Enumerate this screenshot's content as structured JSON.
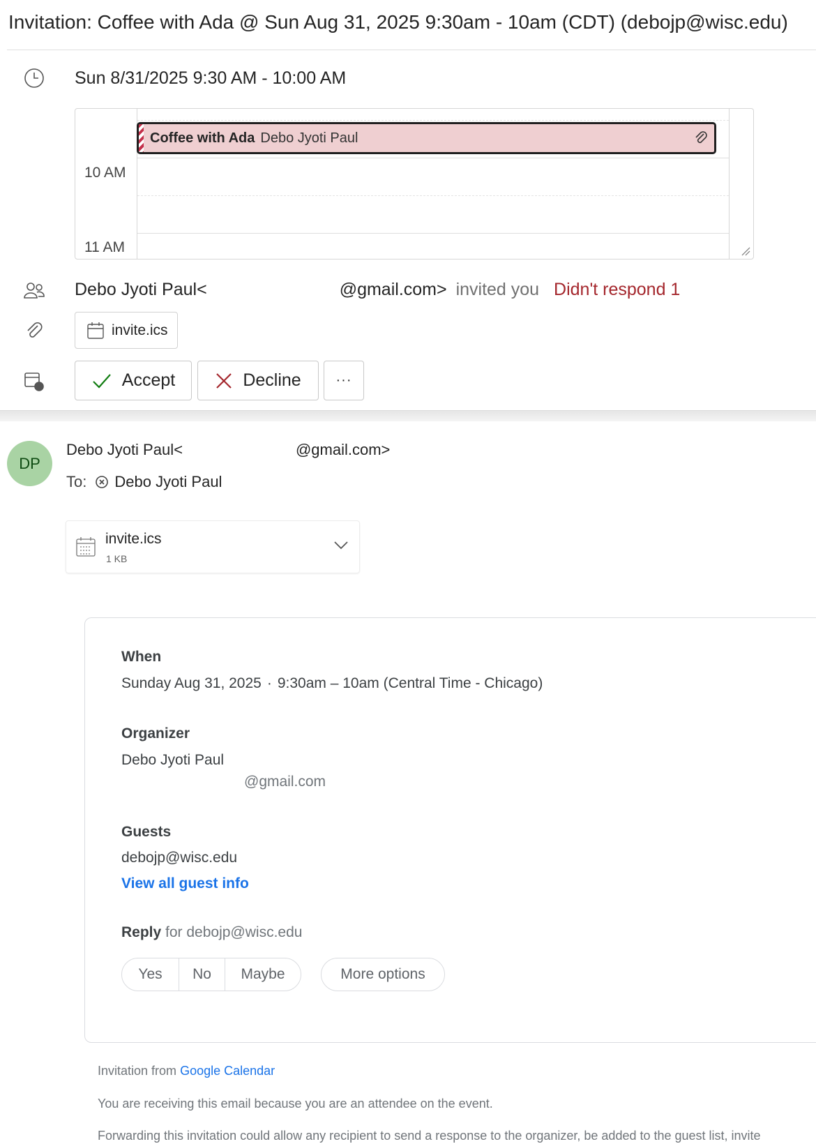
{
  "subject": "Invitation: Coffee with Ada @ Sun Aug 31, 2025 9:30am - 10am (CDT) (debojp@wisc.edu)",
  "event_summary": {
    "when": "Sun 8/31/2025 9:30 AM - 10:00 AM",
    "calendar": {
      "hour_labels": [
        "10 AM",
        "11 AM"
      ],
      "event_title": "Coffee with Ada",
      "event_organizer": "Debo Jyoti Paul"
    },
    "organizer_prefix": "Debo Jyoti Paul<",
    "organizer_suffix": "@gmail.com>",
    "invited_text": "invited you",
    "response_status": "Didn't respond 1",
    "attachment_name": "invite.ics",
    "actions": {
      "accept": "Accept",
      "decline": "Decline",
      "more": "···"
    }
  },
  "message": {
    "avatar_initials": "DP",
    "from_prefix": "Debo Jyoti Paul<",
    "from_suffix": "@gmail.com>",
    "to_label": "To:",
    "to_name": "Debo Jyoti Paul",
    "attachment": {
      "name": "invite.ics",
      "size": "1 KB"
    }
  },
  "gcal": {
    "when_label": "When",
    "when_date": "Sunday Aug 31, 2025",
    "when_dot": "·",
    "when_time": "9:30am – 10am (Central Time - Chicago)",
    "organizer_label": "Organizer",
    "organizer_name": "Debo Jyoti Paul",
    "organizer_email_suffix": "@gmail.com",
    "guests_label": "Guests",
    "guest_email": "debojp@wisc.edu",
    "view_guests_link": "View all guest info",
    "reply_label": "Reply",
    "reply_for": "for debojp@wisc.edu",
    "rsvp": {
      "yes": "Yes",
      "no": "No",
      "maybe": "Maybe",
      "more": "More options"
    }
  },
  "footer": {
    "invitation_from": "Invitation from",
    "google_calendar_link": "Google Calendar",
    "reason": "You are receiving this email because you are an attendee on the event.",
    "forwarding": "Forwarding this invitation could allow any recipient to send a response to the organizer, be added to the guest list, invite"
  },
  "colors": {
    "event_fill": "#efcfd1",
    "event_stripe": "#c4314b",
    "declined_red": "#a4262c",
    "link_blue": "#1a73e8",
    "avatar_green": "#a9d3a4",
    "accept_green": "#107c10"
  },
  "icons": {
    "when": "clock-icon",
    "attendees": "people-icon",
    "attachment": "paperclip-icon",
    "respond": "calendar-reply-icon"
  }
}
